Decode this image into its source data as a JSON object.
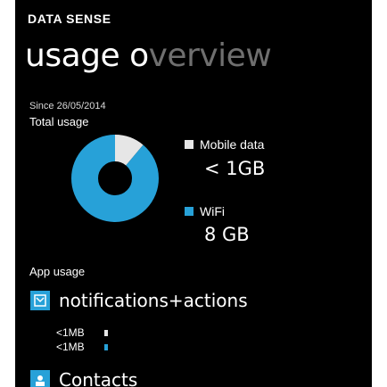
{
  "header": {
    "app_title": "DATA SENSE",
    "page_title_visible": "usage o",
    "page_title_overflow": "verview"
  },
  "summary": {
    "since": "Since 26/05/2014",
    "total_label": "Total usage"
  },
  "chart_data": {
    "type": "pie",
    "categories": [
      "Mobile data",
      "WiFi"
    ],
    "values": [
      1,
      8
    ],
    "units": "GB",
    "value_labels": [
      "< 1GB",
      "8 GB"
    ],
    "colors": [
      "#e6e6e6",
      "#27a1d8"
    ]
  },
  "legend": [
    {
      "label": "Mobile data",
      "value": "< 1GB",
      "color": "#e6e6e6"
    },
    {
      "label": "WiFi",
      "value": "8 GB",
      "color": "#27a1d8"
    }
  ],
  "app_usage": {
    "section_label": "App usage",
    "apps": [
      {
        "name": "notifications+actions",
        "icon": "notifications-icon",
        "mobile": "<1MB",
        "wifi": "<1MB"
      },
      {
        "name": "Contacts",
        "icon": "people-icon"
      }
    ]
  },
  "colors": {
    "accent": "#27a1d8",
    "mobile": "#e6e6e6",
    "background": "#000000"
  }
}
